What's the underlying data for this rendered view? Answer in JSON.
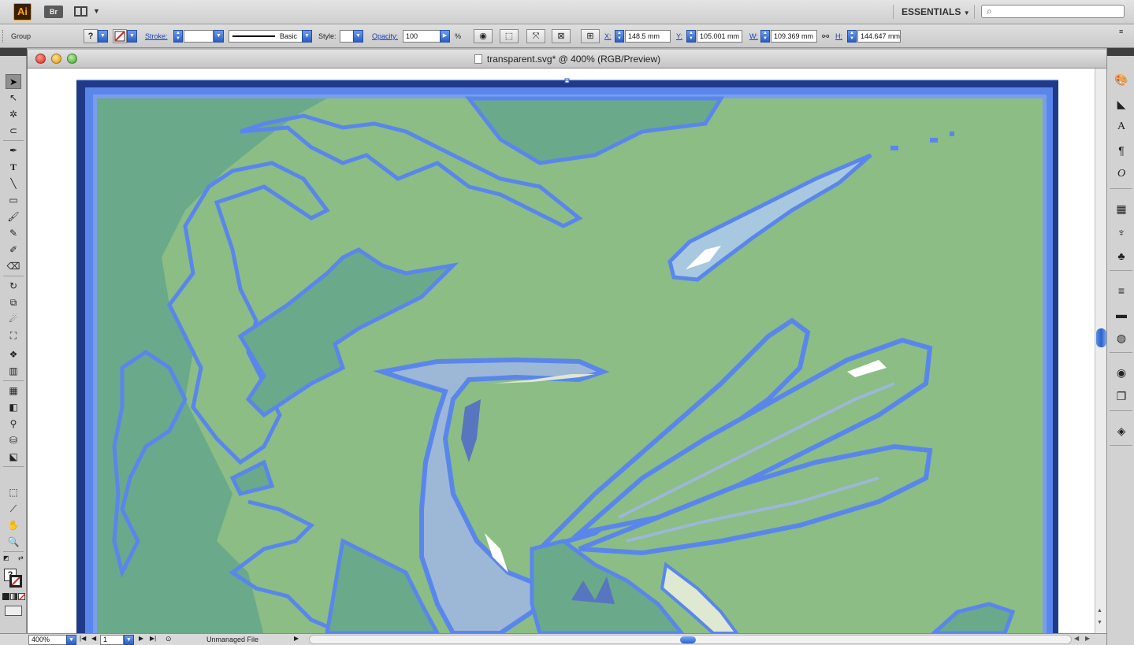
{
  "app": {
    "logo": "Ai",
    "bridge_label": "Br",
    "workspace": "ESSENTIALS",
    "workspace_arrow": "▼"
  },
  "control_bar": {
    "selection_type": "Group",
    "fill_glyph": "?",
    "stroke_label": "Stroke:",
    "stroke_weight": "",
    "brush_label": "Basic",
    "style_label": "Style:",
    "opacity_label": "Opacity:",
    "opacity_value": "100",
    "opacity_unit": "%",
    "x_label": "X:",
    "x_value": "148.5 mm",
    "y_label": "Y:",
    "y_value": "105.001 mm",
    "w_label": "W:",
    "w_value": "109.369 mm",
    "h_label": "H:",
    "h_value": "144.647 mm"
  },
  "document": {
    "title": "transparent.svg* @ 400% (RGB/Preview)"
  },
  "status_bar": {
    "zoom": "400%",
    "artboard": "1",
    "status_text": "Unmanaged File"
  },
  "colors": {
    "background_green": "#8bbd85",
    "shade_green": "#6aa98a",
    "outline_blue": "#5a86ec",
    "frame_navy": "#1f3a86"
  },
  "icons": {
    "tools": [
      "selection-tool",
      "direct-selection-tool",
      "magic-wand-tool",
      "lasso-tool",
      "pen-tool",
      "type-tool",
      "line-tool",
      "rectangle-tool",
      "paintbrush-tool",
      "pencil-tool",
      "blob-brush-tool",
      "eraser-tool",
      "rotate-tool",
      "scale-tool",
      "warp-tool",
      "free-transform-tool",
      "symbol-sprayer-tool",
      "column-graph-tool",
      "mesh-tool",
      "gradient-tool",
      "eyedropper-tool",
      "live-paint-bucket-tool",
      "live-paint-selection-tool",
      "artboard-tool",
      "slice-tool",
      "hand-tool",
      "zoom-tool"
    ]
  }
}
